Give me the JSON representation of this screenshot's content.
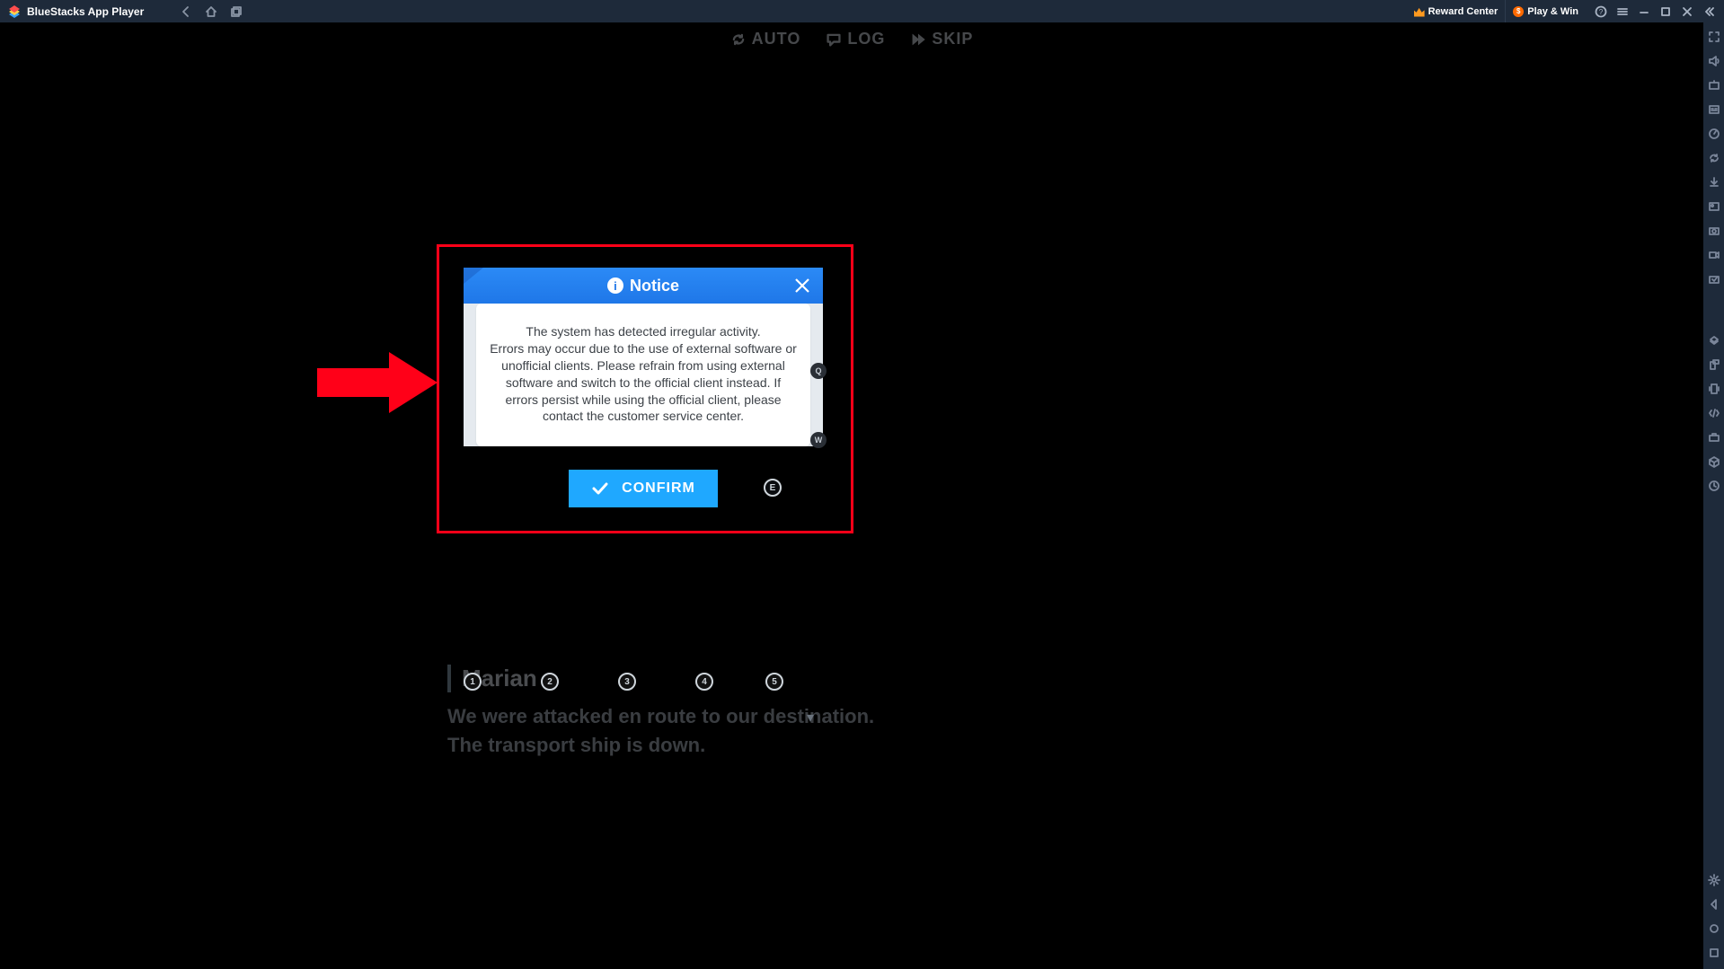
{
  "titlebar": {
    "app_name": "BlueStacks App Player",
    "reward_label": "Reward Center",
    "playwin_label": "Play & Win"
  },
  "game": {
    "topbar": {
      "auto": "AUTO",
      "log": "LOG",
      "skip": "SKIP"
    },
    "dialogue": {
      "speaker": "Marian",
      "line1": "We were attacked en route to our destination.",
      "line2": "The transport ship is down."
    },
    "hotkeys": {
      "k1": "1",
      "k2": "2",
      "k3": "3",
      "k4": "4",
      "k5": "5"
    }
  },
  "notice": {
    "title": "Notice",
    "body_line1": "The system has detected irregular activity.",
    "body_line2": "Errors may occur due to the use of external software or unofficial clients. Please refrain from using external software and switch to the official client instead. If errors persist while using the official client, please contact the customer service center.",
    "confirm": "CONFIRM",
    "key_q": "Q",
    "key_w": "W",
    "key_e": "E"
  }
}
